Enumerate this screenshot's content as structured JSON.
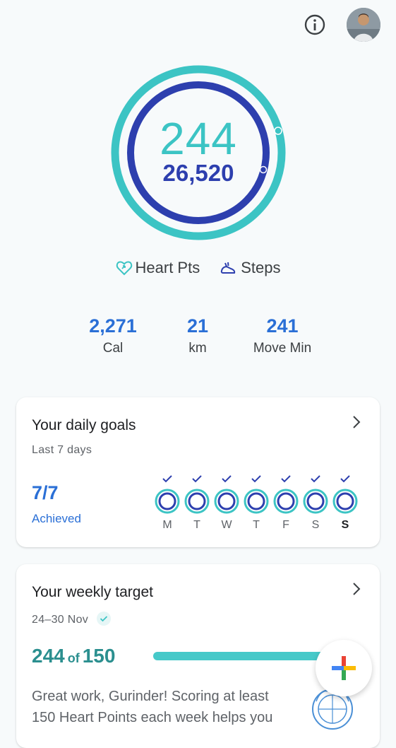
{
  "ring": {
    "heart_points": "244",
    "steps": "26,520",
    "heart_color": "#3cc4c4",
    "steps_color": "#2d3fae"
  },
  "legend": {
    "heart_label": "Heart Pts",
    "steps_label": "Steps"
  },
  "stats": [
    {
      "value": "2,271",
      "label": "Cal"
    },
    {
      "value": "21",
      "label": "km"
    },
    {
      "value": "241",
      "label": "Move Min"
    }
  ],
  "daily_goals": {
    "title": "Your daily goals",
    "subtitle": "Last 7 days",
    "achieved_count": "7/7",
    "achieved_label": "Achieved",
    "days": [
      "M",
      "T",
      "W",
      "T",
      "F",
      "S",
      "S"
    ]
  },
  "weekly_target": {
    "title": "Your weekly target",
    "date_range": "24–30 Nov",
    "score": "244",
    "of": "of",
    "target": "150",
    "progress": 1.0,
    "message": "Great work, Gurinder! Scoring at least 150 Heart Points each week helps you"
  },
  "icons": {
    "info": "info-icon",
    "avatar": "profile-avatar",
    "heart": "heart-points-icon",
    "steps": "steps-icon",
    "chevron": "chevron-right-icon",
    "check": "check-icon",
    "add": "add-plus-icon",
    "who": "who-logo"
  }
}
